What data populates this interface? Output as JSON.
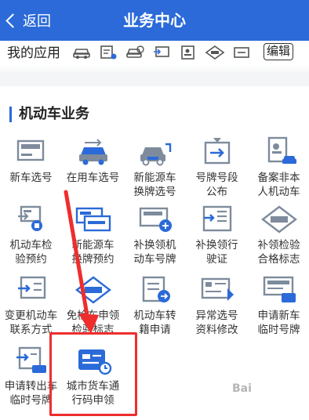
{
  "header": {
    "back_label": "返回",
    "title": "业务中心"
  },
  "myapps": {
    "label": "我的应用",
    "edit_label": "编辑"
  },
  "section": {
    "title": "机动车业务"
  },
  "tiles": [
    {
      "label": "新车选号",
      "icon": "new-car-plate-icon"
    },
    {
      "label": "在用车选号",
      "icon": "used-car-plate-icon"
    },
    {
      "label": "新能源车\n换牌选号",
      "icon": "new-energy-car-icon"
    },
    {
      "label": "号牌号段\n公布",
      "icon": "plate-announce-icon"
    },
    {
      "label": "备案非本\n人机动车",
      "icon": "record-vehicle-icon"
    },
    {
      "label": "机动车检\n验预约",
      "icon": "inspection-appointment-icon"
    },
    {
      "label": "新能源车\n换牌预约",
      "icon": "plate-change-appointment-icon"
    },
    {
      "label": "补换领机\n动车号牌",
      "icon": "replace-plate-icon"
    },
    {
      "label": "补换领行\n驶证",
      "icon": "replace-license-icon"
    },
    {
      "label": "补领检验\n合格标志",
      "icon": "inspection-mark-icon"
    },
    {
      "label": "变更机动车\n联系方式",
      "icon": "change-contact-icon"
    },
    {
      "label": "免检车申领\n检验标志",
      "icon": "exempt-mark-icon"
    },
    {
      "label": "机动车转\n籍申请",
      "icon": "transfer-icon"
    },
    {
      "label": "异常选号\n资料修改",
      "icon": "abnormal-edit-icon"
    },
    {
      "label": "申请新车\n临时号牌",
      "icon": "temp-plate-new-icon"
    },
    {
      "label": "申请转出车\n临时号牌",
      "icon": "temp-plate-transfer-icon"
    },
    {
      "label": "城市货车通\n行码申领",
      "icon": "truck-pass-icon"
    }
  ],
  "watermark": "Bai",
  "colors": {
    "primary": "#2b6ad8",
    "highlight": "#ef2d2d"
  }
}
